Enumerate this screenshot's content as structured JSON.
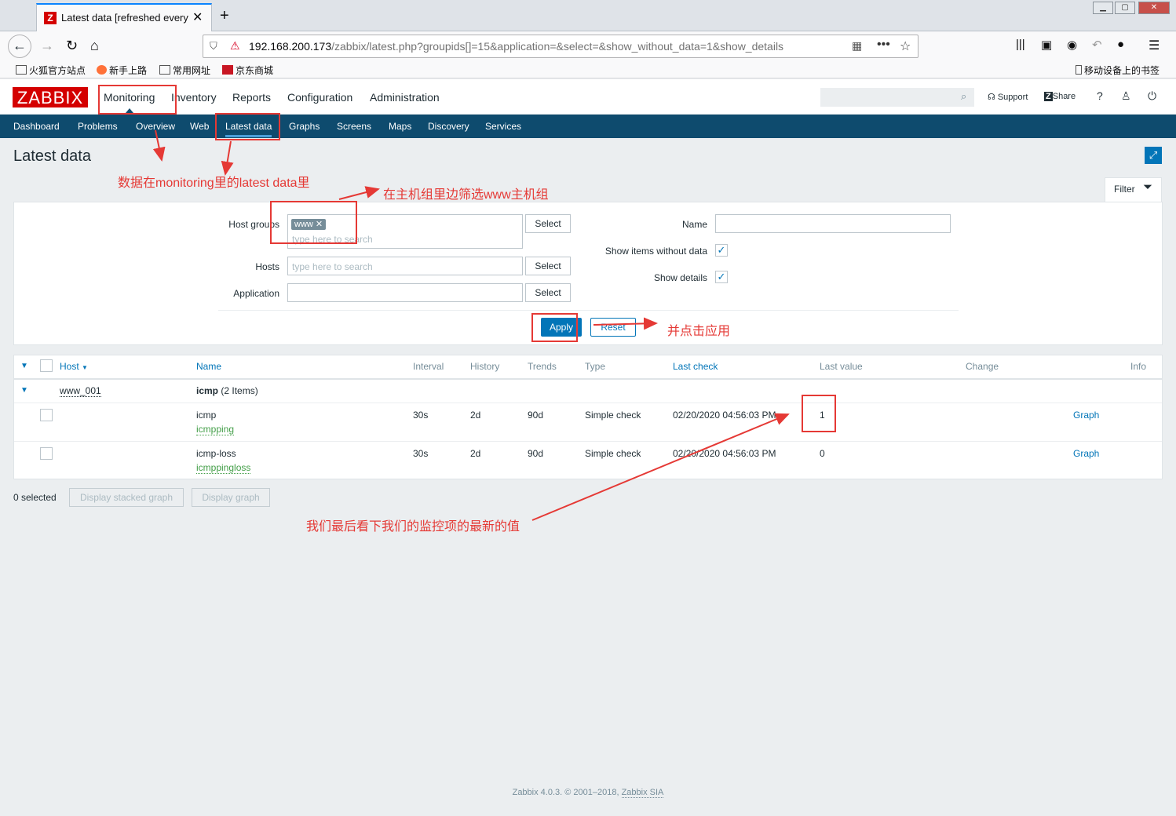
{
  "browser": {
    "tab_title": "Latest data [refreshed every",
    "tab_icon": "Z",
    "url_host": "192.168.200.173",
    "url_path": "/zabbix/latest.php?groupids[]=15&application=&select=&show_without_data=1&show_details",
    "bookmarks": [
      "火狐官方站点",
      "新手上路",
      "常用网址",
      "京东商城"
    ],
    "mobile_bookmarks": "移动设备上的书签"
  },
  "header": {
    "logo": "ZABBIX",
    "menu": [
      "Monitoring",
      "Inventory",
      "Reports",
      "Configuration",
      "Administration"
    ],
    "support": "Support",
    "share": "Share",
    "help": "?"
  },
  "submenu": [
    "Dashboard",
    "Problems",
    "Overview",
    "Web",
    "Latest data",
    "Graphs",
    "Screens",
    "Maps",
    "Discovery",
    "Services"
  ],
  "page": {
    "title": "Latest data",
    "filter_tab": "Filter"
  },
  "filter": {
    "host_groups_label": "Host groups",
    "host_groups_tag": "www",
    "type_here": "type here to search",
    "hosts_label": "Hosts",
    "application_label": "Application",
    "select_label": "Select",
    "name_label": "Name",
    "show_without_data_label": "Show items without data",
    "show_details_label": "Show details",
    "apply_label": "Apply",
    "reset_label": "Reset"
  },
  "table": {
    "headers": {
      "host": "Host",
      "name": "Name",
      "interval": "Interval",
      "history": "History",
      "trends": "Trends",
      "type": "Type",
      "last_check": "Last check",
      "last_value": "Last value",
      "change": "Change",
      "info": "Info"
    },
    "host": "www_001",
    "app_name": "icmp",
    "app_count": "(2 Items)",
    "rows": [
      {
        "name": "icmp",
        "key": "icmpping",
        "interval": "30s",
        "history": "2d",
        "trends": "90d",
        "type": "Simple check",
        "last_check": "02/20/2020 04:56:03 PM",
        "last_value": "1",
        "graph": "Graph"
      },
      {
        "name": "icmp-loss",
        "key": "icmppingloss",
        "interval": "30s",
        "history": "2d",
        "trends": "90d",
        "type": "Simple check",
        "last_check": "02/20/2020 04:56:03 PM",
        "last_value": "0",
        "graph": "Graph"
      }
    ]
  },
  "bottom": {
    "selected": "0 selected",
    "display_stacked": "Display stacked graph",
    "display_graph": "Display graph"
  },
  "footer": {
    "text": "Zabbix 4.0.3. © 2001–2018, ",
    "link": "Zabbix SIA"
  },
  "annotations": {
    "a1": "数据在monitoring里的latest data里",
    "a2": "在主机组里边筛选www主机组",
    "a3": "并点击应用",
    "a4": "我们最后看下我们的监控项的最新的值"
  }
}
